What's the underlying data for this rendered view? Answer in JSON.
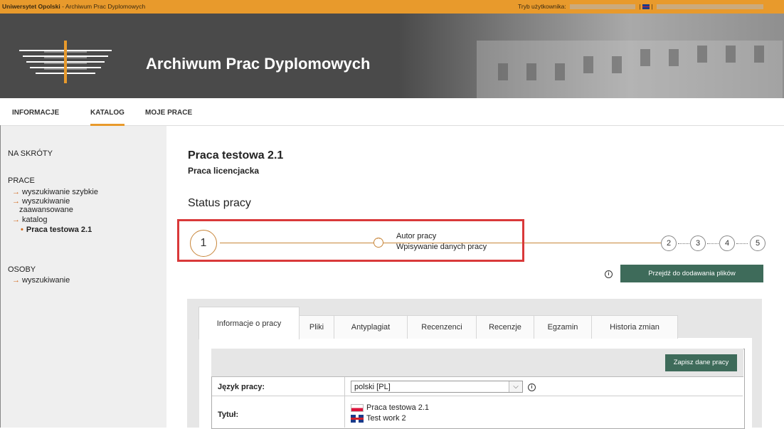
{
  "topbar": {
    "university": "Uniwersytet Opolski",
    "separator": " - ",
    "app_name": "Archiwum Prac Dyplomowych",
    "mode_label": "Tryb użytkownika:",
    "divider": "|"
  },
  "banner": {
    "title": "Archiwum Prac Dyplomowych",
    "logo_icon": "university-logo-icon"
  },
  "nav": {
    "items": [
      "INFORMACJE",
      "KATALOG",
      "MOJE PRACE"
    ],
    "active": "KATALOG"
  },
  "sidebar": {
    "shortcuts": "NA SKRÓTY",
    "prace": "PRACE",
    "links": [
      "wyszukiwanie szybkie",
      "wyszukiwanie",
      "zaawansowane",
      "katalog",
      "Praca testowa 2.1"
    ],
    "osoby": "OSOBY",
    "osoby_links": [
      "wyszukiwanie"
    ],
    "arrow": "→",
    "bullet": "•"
  },
  "main": {
    "title": "Praca testowa 2.1",
    "subtitle": "Praca licencjacka",
    "status_heading": "Status pracy"
  },
  "progress": {
    "current_step": "1",
    "steps": [
      "2",
      "3",
      "4",
      "5"
    ],
    "label_line1": "Autor pracy",
    "label_line2": "Wpisywanie danych pracy"
  },
  "actions": {
    "add_files": "Przejdź do dodawania plików",
    "save": "Zapisz dane pracy",
    "info": "i"
  },
  "tabs": [
    "Informacje o pracy",
    "Pliki",
    "Antyplagiat",
    "Recenzenci",
    "Recenzje",
    "Egzamin",
    "Historia zmian"
  ],
  "form": {
    "language_label": "Język pracy:",
    "language_value": "polski [PL]",
    "chevron": "⌵",
    "title_label": "Tytuł:",
    "title_pl": "Praca testowa 2.1",
    "title_en": "Test work 2"
  },
  "colors": {
    "accent": "#e89a2c",
    "banner": "#4a4a4a",
    "button": "#3e6b5a",
    "highlight": "#d9393a",
    "progress": "#c8863a"
  }
}
